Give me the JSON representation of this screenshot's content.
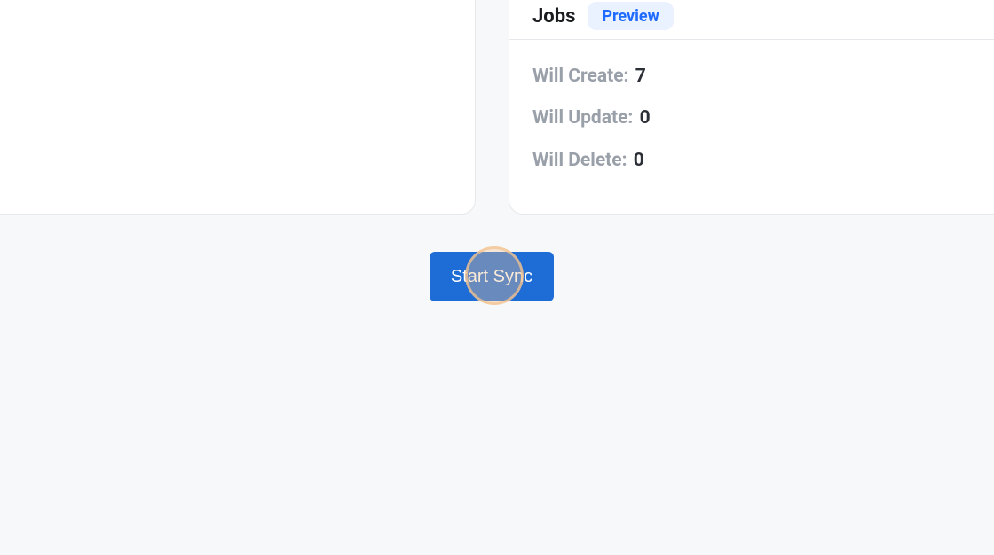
{
  "right_card": {
    "title": "Jobs",
    "badge": "Preview",
    "stats": {
      "will_create_label": "Will Create:",
      "will_create_value": "7",
      "will_update_label": "Will Update:",
      "will_update_value": "0",
      "will_delete_label": "Will Delete:",
      "will_delete_value": "0"
    }
  },
  "buttons": {
    "start_sync": "Start Sync"
  }
}
